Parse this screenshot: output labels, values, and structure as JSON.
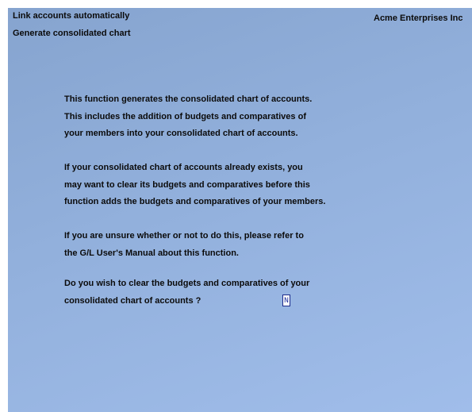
{
  "header": {
    "title": "Link accounts automatically",
    "subtitle": "Generate consolidated chart",
    "company": "Acme Enterprises Inc"
  },
  "body": {
    "paragraph1": [
      "This function generates the consolidated chart of accounts.",
      "This includes the addition of budgets and comparatives of",
      "your members into your consolidated chart of accounts."
    ],
    "paragraph2": [
      "If your consolidated chart of accounts already exists, you",
      "may want to clear its budgets and comparatives before this",
      "function adds the budgets and comparatives of your members."
    ],
    "paragraph3": [
      "If you are unsure whether or not to do this, please refer to",
      "the G/L User's Manual about this function."
    ],
    "question": [
      "Do you wish to clear the budgets and comparatives of your",
      "consolidated chart of accounts ?"
    ]
  },
  "answer_field": {
    "value": "N"
  },
  "colors": {
    "background_start": "#86a4cf",
    "background_end": "#a0bdea",
    "text": "#0b0b0b",
    "field_border": "#1b2a8a"
  }
}
